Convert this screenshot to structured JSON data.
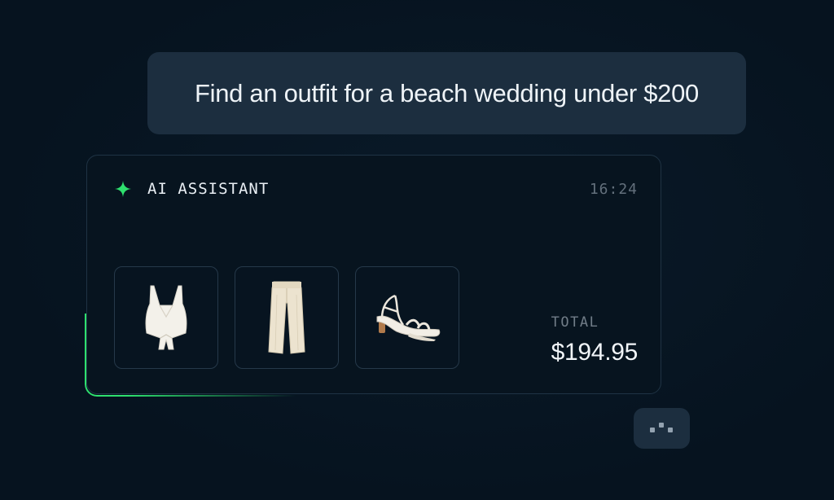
{
  "user_message": {
    "text": "Find an outfit for a beach wedding under $200"
  },
  "assistant_card": {
    "label": "AI ASSISTANT",
    "timestamp": "16:24",
    "icon": "sparkle-icon",
    "products": [
      {
        "icon": "white-crop-top-icon"
      },
      {
        "icon": "linen-pants-icon"
      },
      {
        "icon": "strappy-sandals-icon"
      }
    ],
    "total_label": "TOTAL",
    "total_value": "$194.95"
  },
  "typing_indicator": {
    "icon": "typing-dots-icon"
  },
  "colors": {
    "background": "#06131f",
    "bubble": "#1c2e3f",
    "accent_green": "#2ee06e",
    "card_border": "#1f3344",
    "text_primary": "#eef3f7",
    "text_muted": "#63707c"
  }
}
